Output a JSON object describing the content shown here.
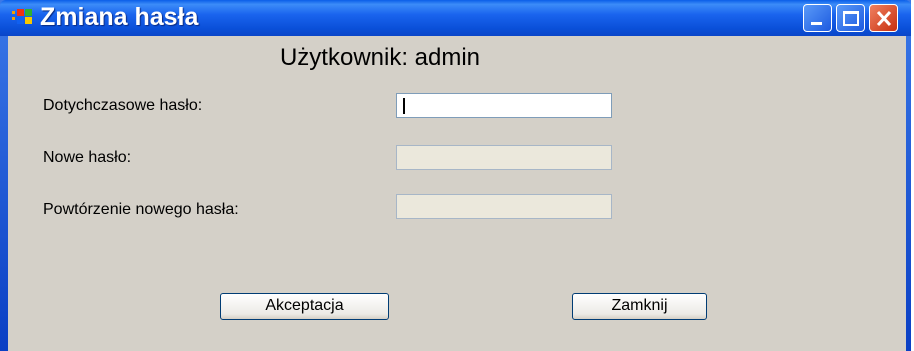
{
  "window": {
    "title": "Zmiana hasła",
    "controls": {
      "minimize": "minimize-icon",
      "maximize": "maximize-icon",
      "close": "close-icon"
    }
  },
  "header": {
    "user_label": "Użytkownik: admin"
  },
  "form": {
    "current_password_label": "Dotychczasowe hasło:",
    "new_password_label": "Nowe hasło:",
    "repeat_password_label": "Powtórzenie nowego hasła:"
  },
  "buttons": {
    "accept_label": "Akceptacja",
    "close_label": "Zamknij"
  },
  "colors": {
    "titlebar": "#0a50d8",
    "window_bg": "#d4d0c8",
    "disabled_field": "#ebe8dc"
  }
}
